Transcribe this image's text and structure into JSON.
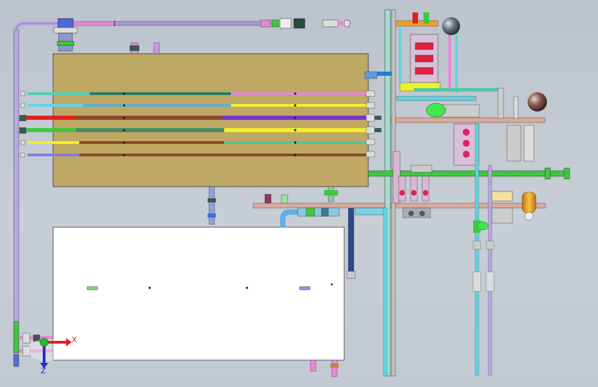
{
  "viewport": {
    "background_top": "#bcc3cc",
    "background_bottom": "#c3c9d2"
  },
  "axes": {
    "x_label": "X",
    "z_label": "Z",
    "x_color": "#e0201c",
    "y_color": "#2bb92b",
    "z_color": "#2030c0"
  },
  "colors": {
    "upper_tank": "#bfa863",
    "lower_tank": "#ffffff",
    "frame": "#d9a99a",
    "pipe_pink": "#e38ad6",
    "pipe_cyan": "#5fd6e6",
    "pipe_green": "#3ec83e",
    "pipe_yellow": "#f0f02a",
    "pipe_red": "#e02020",
    "pipe_purple": "#7a2fd0",
    "pipe_brown": "#8a4a2a",
    "pipe_blue": "#4a6ad8",
    "pipe_lavender": "#b9a6e6",
    "sphere": "#7a4a44",
    "vessel_orange": "#f0a020"
  }
}
